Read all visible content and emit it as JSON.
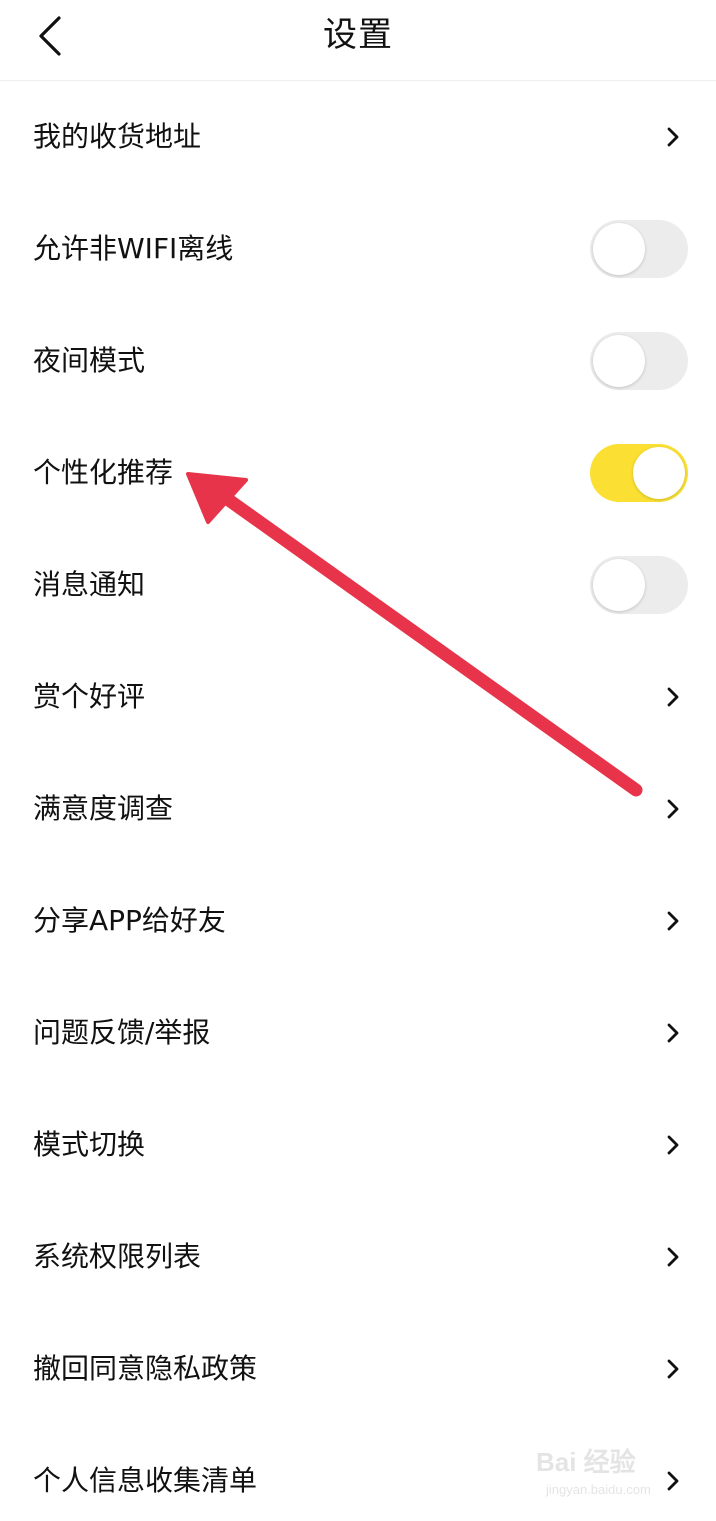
{
  "header": {
    "title": "设置",
    "back_icon": "chevron-left-icon"
  },
  "rows": [
    {
      "label": "我的收货地址",
      "control": "chevron"
    },
    {
      "label": "允许非WIFI离线",
      "control": "toggle",
      "on": false
    },
    {
      "label": "夜间模式",
      "control": "toggle",
      "on": false
    },
    {
      "label": "个性化推荐",
      "control": "toggle",
      "on": true
    },
    {
      "label": "消息通知",
      "control": "toggle",
      "on": false
    },
    {
      "label": "赏个好评",
      "control": "chevron"
    },
    {
      "label": "满意度调查",
      "control": "chevron"
    },
    {
      "label": "分享APP给好友",
      "control": "chevron"
    },
    {
      "label": "问题反馈/举报",
      "control": "chevron"
    },
    {
      "label": "模式切换",
      "control": "chevron"
    },
    {
      "label": "系统权限列表",
      "control": "chevron"
    },
    {
      "label": "撤回同意隐私政策",
      "control": "chevron"
    },
    {
      "label": "个人信息收集清单",
      "control": "chevron"
    }
  ],
  "annotation": {
    "arrow_color": "#e8344a",
    "points_to": "个性化推荐"
  },
  "watermark": {
    "main": "Bai 经验",
    "sub": "jingyan.baidu.com"
  },
  "colors": {
    "toggle_on": "#fbe033",
    "toggle_off": "#ececec"
  }
}
